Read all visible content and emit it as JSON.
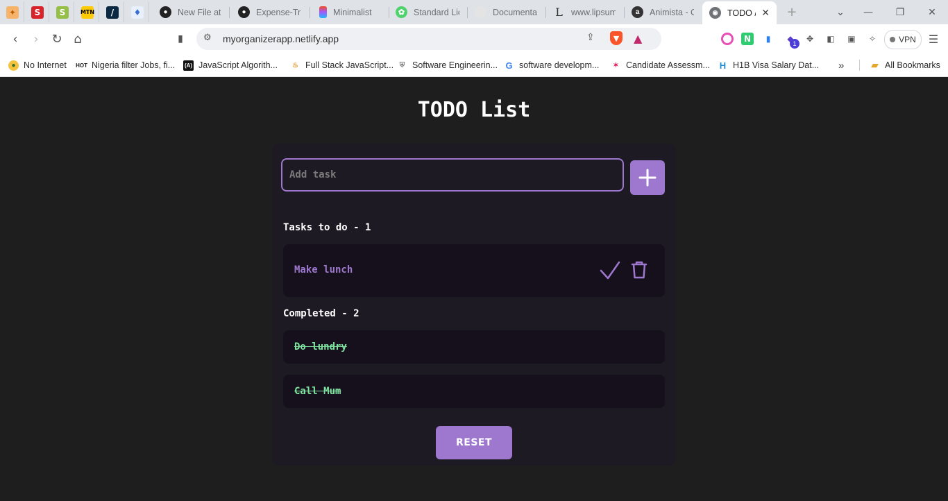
{
  "browser": {
    "tabs": [
      {
        "label": "New File at",
        "icon": "github-icon"
      },
      {
        "label": "Expense-Tra",
        "icon": "github-icon"
      },
      {
        "label": "Minimalist",
        "icon": "figma-icon"
      },
      {
        "label": "Standard Lic",
        "icon": "clover-icon"
      },
      {
        "label": "Documenta",
        "icon": "globe-icon"
      },
      {
        "label": "www.lipsum",
        "icon": "lipsum-icon"
      },
      {
        "label": "Animista - C",
        "icon": "animista-icon"
      }
    ],
    "active_tab": {
      "label": "TODO /",
      "icon": "globe-icon"
    },
    "url": "myorganizerapp.netlify.app",
    "vpn_label": "VPN",
    "notification_badge": "1",
    "bookmarks": [
      "No Internet",
      "Nigeria filter Jobs, fi...",
      "JavaScript Algorith...",
      "Full Stack JavaScript...",
      "Software Engineerin...",
      "software developm...",
      "Candidate Assessm...",
      "H1B Visa Salary Dat..."
    ],
    "all_bookmarks": "All Bookmarks"
  },
  "app": {
    "title": "TODO List",
    "input_placeholder": "Add task",
    "todo_header": "Tasks to do - 1",
    "todo_items": [
      "Make lunch"
    ],
    "completed_header": "Completed - 2",
    "completed_items": [
      "Do lundry",
      "Call Mum"
    ],
    "reset_label": "RESET"
  },
  "colors": {
    "accent": "#9e78cf",
    "completed": "#7ee39f",
    "background": "#1e1e1e",
    "card": "#1d1a24",
    "row": "#15101c"
  }
}
